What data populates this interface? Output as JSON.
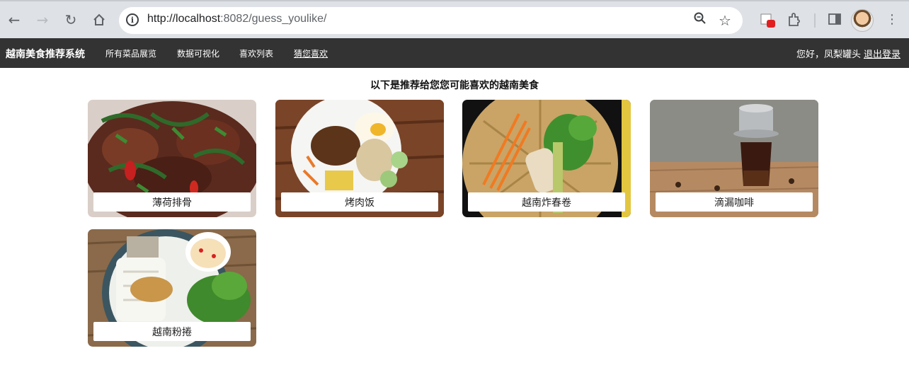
{
  "browser": {
    "url_host": "http://localhost",
    "url_rest": ":8082/guess_youlike/"
  },
  "navbar": {
    "brand": "越南美食推荐系统",
    "links": [
      "所有菜品展览",
      "数据可视化",
      "喜欢列表",
      "猜您喜欢"
    ],
    "greeting": "您好，凤梨罐头",
    "logout": "退出登录"
  },
  "page": {
    "heading": "以下是推荐给您您可能喜欢的越南美食"
  },
  "dishes": [
    {
      "name": "薄荷排骨"
    },
    {
      "name": "烤肉饭"
    },
    {
      "name": "越南炸春卷"
    },
    {
      "name": "滴漏咖啡"
    },
    {
      "name": "越南粉捲"
    }
  ]
}
